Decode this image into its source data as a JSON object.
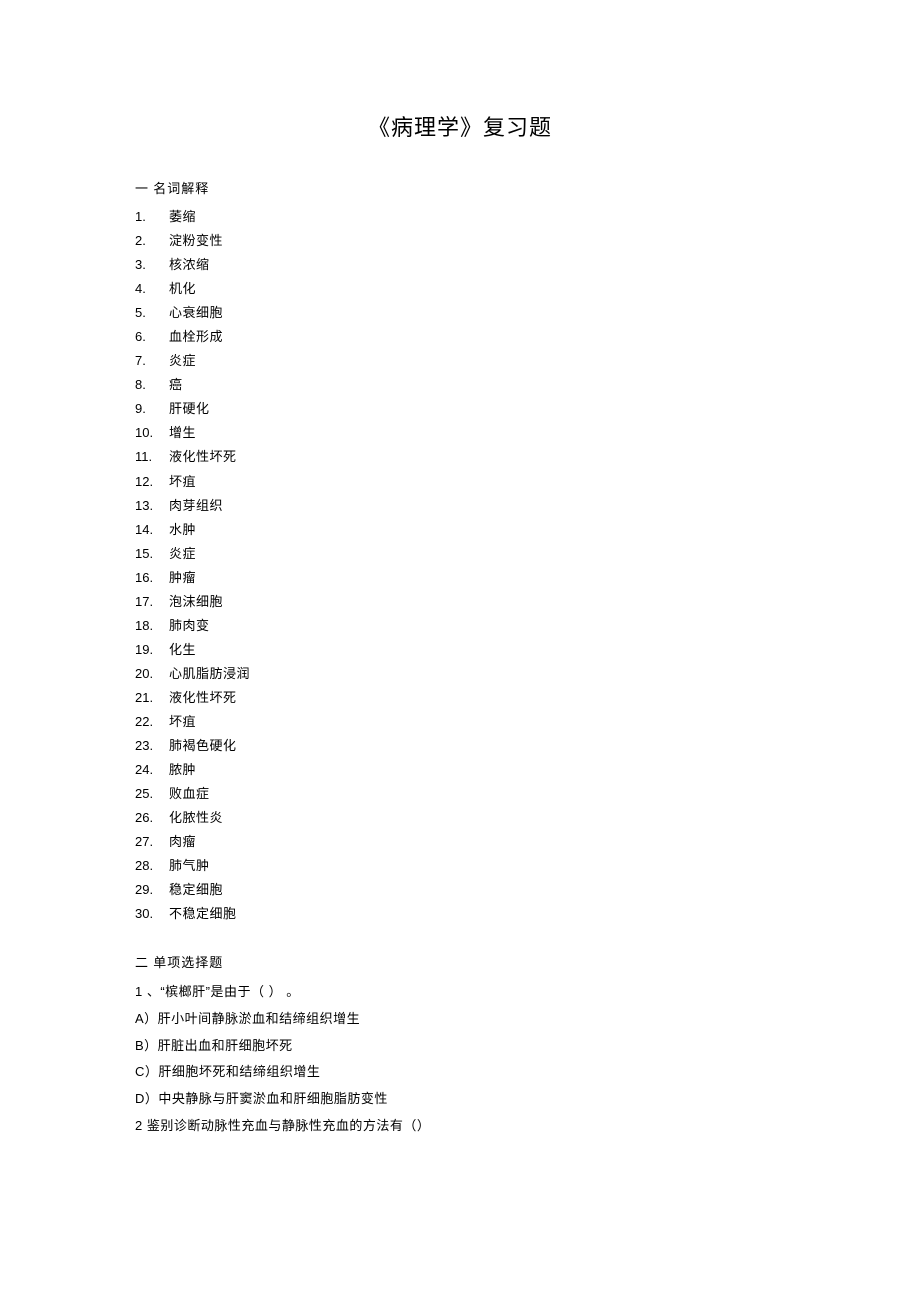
{
  "title": "《病理学》复习题",
  "section1": {
    "heading": "一 名词解释",
    "terms": [
      {
        "num": "1.",
        "text": "萎缩"
      },
      {
        "num": "2.",
        "text": "淀粉变性"
      },
      {
        "num": "3.",
        "text": "核浓缩"
      },
      {
        "num": "4.",
        "text": "机化"
      },
      {
        "num": "5.",
        "text": "心衰细胞"
      },
      {
        "num": "6.",
        "text": "血栓形成"
      },
      {
        "num": "7.",
        "text": "炎症"
      },
      {
        "num": "8.",
        "text": "癌"
      },
      {
        "num": "9.",
        "text": "肝硬化"
      },
      {
        "num": "10.",
        "text": "增生"
      },
      {
        "num": "11.",
        "text": "液化性坏死"
      },
      {
        "num": "12.",
        "text": "坏疽"
      },
      {
        "num": "13.",
        "text": "肉芽组织"
      },
      {
        "num": "14.",
        "text": "水肿"
      },
      {
        "num": "15.",
        "text": "炎症"
      },
      {
        "num": "16.",
        "text": "肿瘤"
      },
      {
        "num": "17.",
        "text": "泡沫细胞"
      },
      {
        "num": "18.",
        "text": "肺肉变"
      },
      {
        "num": "19.",
        "text": "化生"
      },
      {
        "num": "20.",
        "text": "心肌脂肪浸润"
      },
      {
        "num": "21.",
        "text": "液化性坏死"
      },
      {
        "num": "22.",
        "text": "坏疽"
      },
      {
        "num": "23.",
        "text": "肺褐色硬化"
      },
      {
        "num": "24.",
        "text": "脓肿"
      },
      {
        "num": "25.",
        "text": "败血症"
      },
      {
        "num": "26.",
        "text": "化脓性炎"
      },
      {
        "num": "27.",
        "text": "肉瘤"
      },
      {
        "num": "28.",
        "text": "肺气肿"
      },
      {
        "num": "29.",
        "text": "稳定细胞"
      },
      {
        "num": "30.",
        "text": "不稳定细胞"
      }
    ]
  },
  "section2": {
    "heading": "二 单项选择题",
    "questions": [
      {
        "stem_num": "1 、",
        "stem_text": "“槟榔肝”是由于（  ） 。",
        "options": [
          {
            "label": "A）",
            "text": "肝小叶间静脉淤血和结缔组织增生"
          },
          {
            "label": "B）",
            "text": "肝脏出血和肝细胞坏死"
          },
          {
            "label": "C）",
            "text": "肝细胞坏死和结缔组织增生"
          },
          {
            "label": "D）",
            "text": "中央静脉与肝窦淤血和肝细胞脂肪变性"
          }
        ]
      },
      {
        "stem_num": "2",
        "stem_text": " 鉴别诊断动脉性充血与静脉性充血的方法有（）",
        "options": []
      }
    ]
  }
}
